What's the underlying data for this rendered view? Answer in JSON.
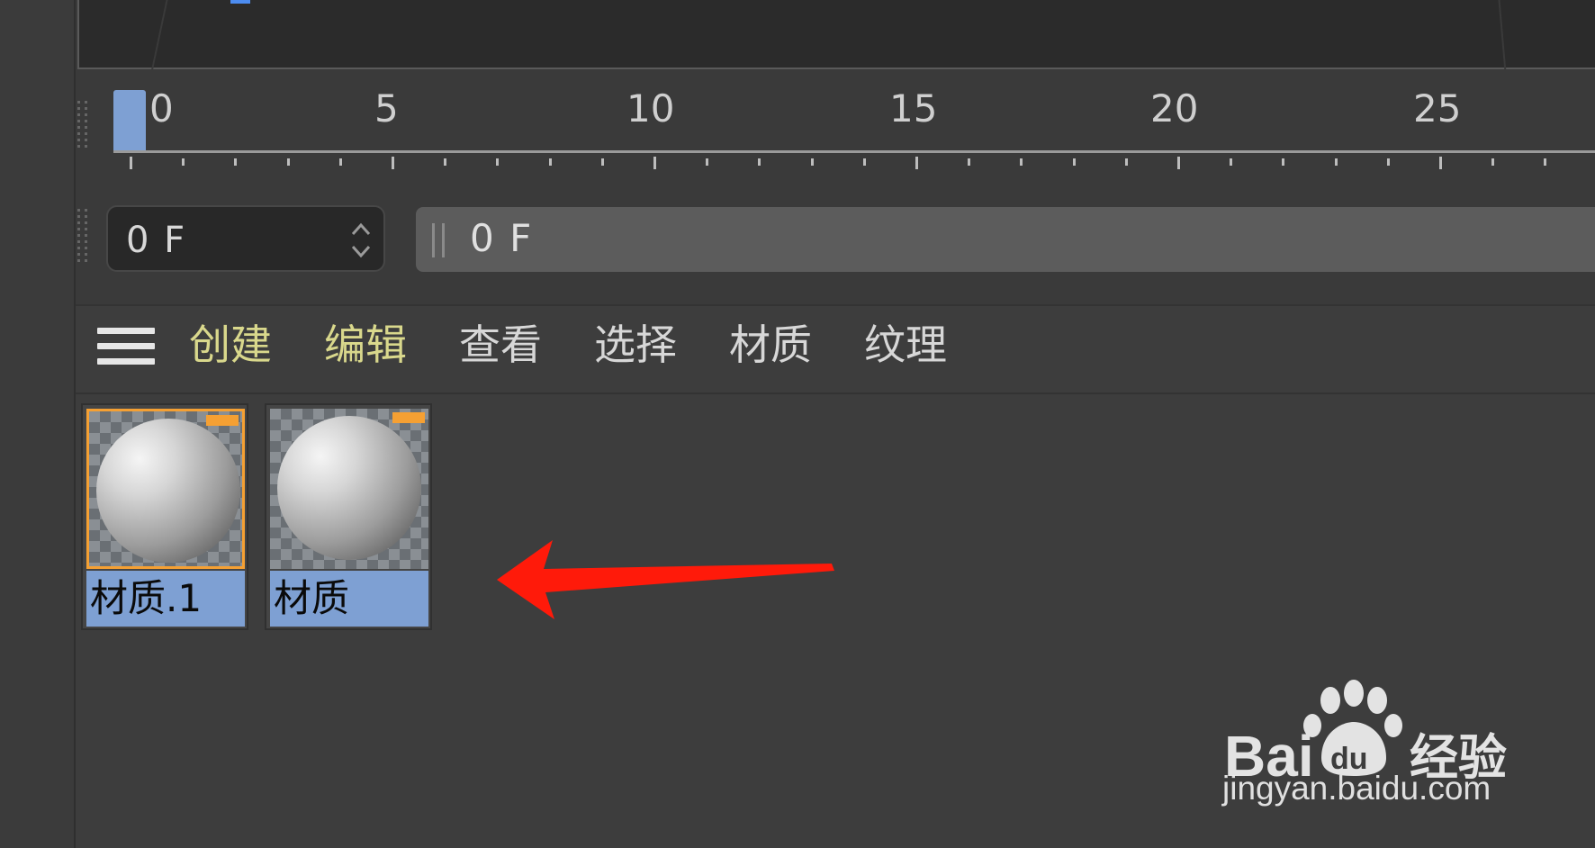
{
  "timeline": {
    "tick_labels": [
      "0",
      "5",
      "10",
      "15",
      "20",
      "25"
    ],
    "current_frame": "0 F",
    "range_start": "0 F"
  },
  "material_manager": {
    "menu": [
      "创建",
      "编辑",
      "查看",
      "选择",
      "材质",
      "纹理"
    ],
    "materials": [
      {
        "name": "材质.1",
        "selected": true
      },
      {
        "name": "材质",
        "selected": false
      }
    ]
  },
  "colors": {
    "accent_menu": "#d9d88c",
    "selection": "#7ea0d3",
    "highlight": "#f5a033",
    "arrow": "#ff1a0a"
  },
  "watermark": {
    "brand": "Bai du 经验",
    "url": "jingyan.baidu.com"
  }
}
